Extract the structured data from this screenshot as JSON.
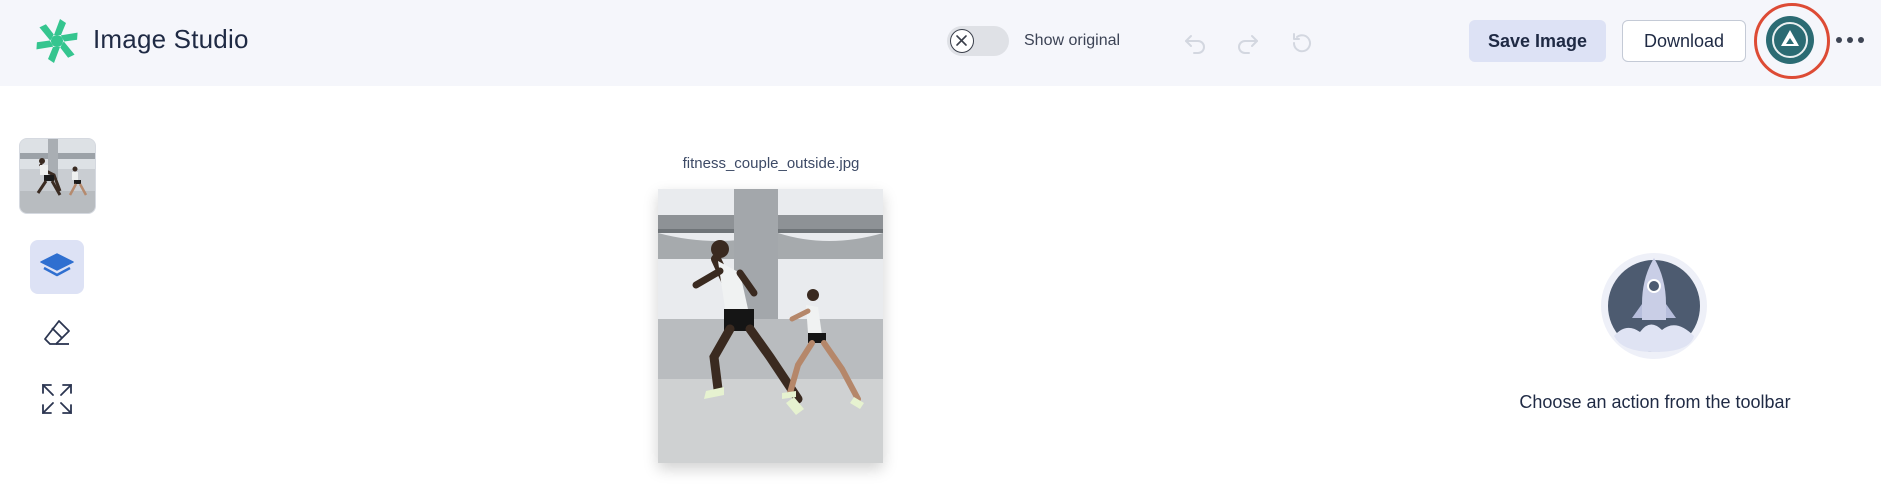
{
  "header": {
    "app_title": "Image Studio",
    "logo_icon": "pinwheel-logo-icon",
    "toggle_label": "Show original",
    "toggle_state": "off",
    "save_label": "Save Image",
    "download_label": "Download",
    "history_icons": [
      "undo-icon",
      "redo-icon",
      "reset-icon"
    ]
  },
  "sidebar": {
    "tools": [
      {
        "name": "layers-icon",
        "active": true
      },
      {
        "name": "eraser-icon",
        "active": false
      },
      {
        "name": "expand-icon",
        "active": false
      }
    ]
  },
  "canvas": {
    "filename": "fitness_couple_outside.jpg"
  },
  "panel": {
    "empty_message": "Choose an action from the toolbar",
    "illustration_icon": "rocket-icon"
  },
  "colors": {
    "header_bg": "#f5f6fb",
    "accent_soft": "#dde2f5",
    "avatar_bg": "#2b6b73",
    "highlight_ring": "#dd4b35",
    "logo_green": "#35c58f"
  }
}
